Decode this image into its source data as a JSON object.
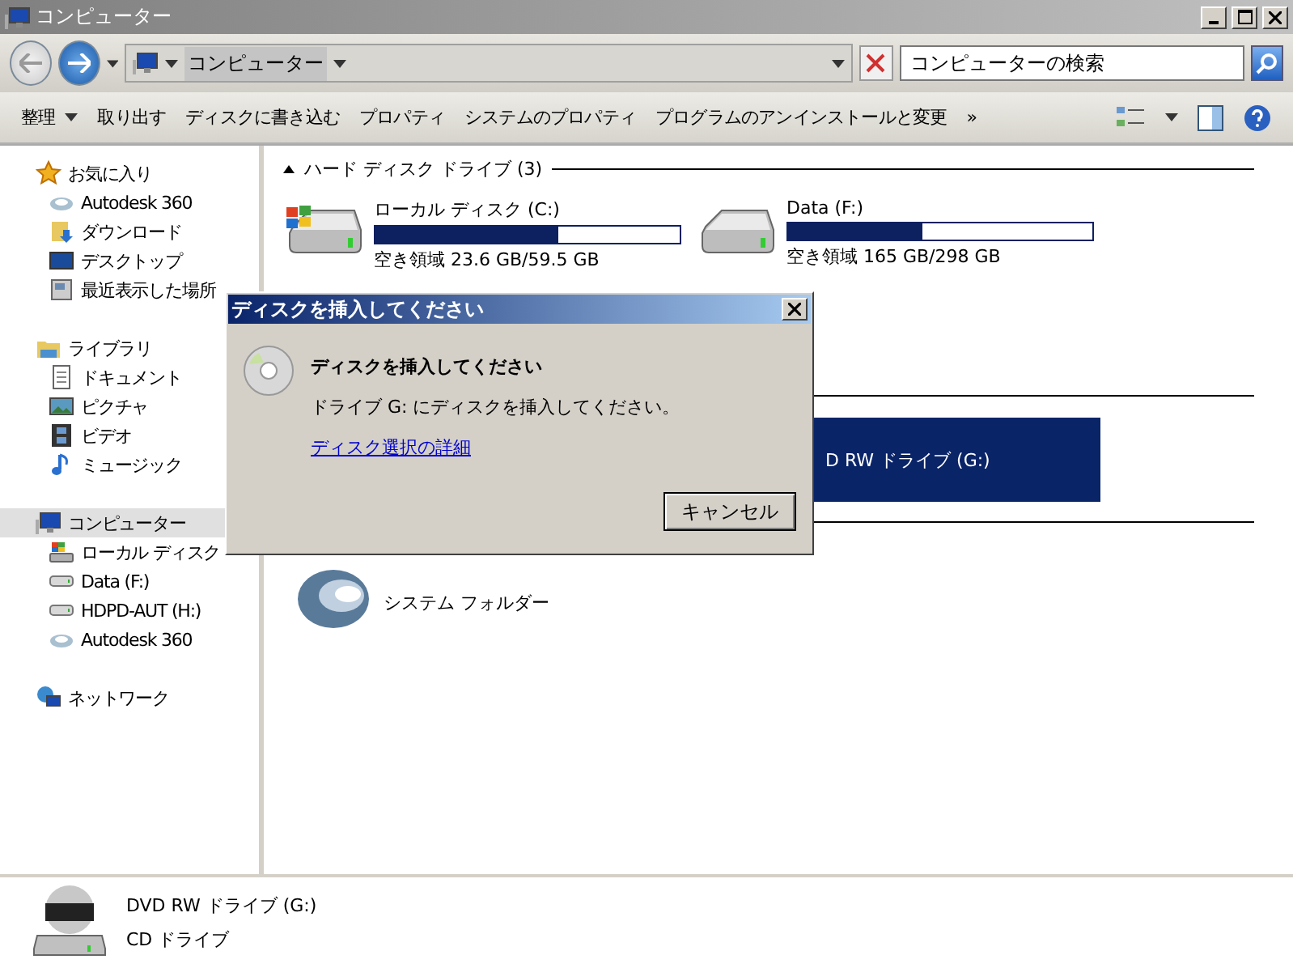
{
  "window": {
    "title": "コンピューター"
  },
  "address": {
    "path": "コンピューター",
    "search_placeholder": "コンピューターの検索"
  },
  "toolbar": [
    {
      "label": "整理",
      "has_menu": true
    },
    {
      "label": "取り出す",
      "has_menu": false
    },
    {
      "label": "ディスクに書き込む",
      "has_menu": false
    },
    {
      "label": "プロパティ",
      "has_menu": false
    },
    {
      "label": "システムのプロパティ",
      "has_menu": false
    },
    {
      "label": "プログラムのアンインストールと変更",
      "has_menu": false
    },
    {
      "label": "»",
      "has_menu": false
    }
  ],
  "sidebar": [
    {
      "label": "お気に入り",
      "kind": "star",
      "selected": false,
      "children": [
        {
          "label": "Autodesk 360",
          "kind": "cloud",
          "selected": false
        },
        {
          "label": "ダウンロード",
          "kind": "download",
          "selected": false
        },
        {
          "label": "デスクトップ",
          "kind": "desktop",
          "selected": false
        },
        {
          "label": "最近表示した場所",
          "kind": "recent",
          "selected": false
        }
      ]
    },
    {
      "label": "ライブラリ",
      "kind": "library",
      "selected": false,
      "children": [
        {
          "label": "ドキュメント",
          "kind": "document",
          "selected": false
        },
        {
          "label": "ピクチャ",
          "kind": "picture",
          "selected": false
        },
        {
          "label": "ビデオ",
          "kind": "video",
          "selected": false
        },
        {
          "label": "ミュージック",
          "kind": "music",
          "selected": false
        }
      ]
    },
    {
      "label": "コンピューター",
      "kind": "computer",
      "selected": true,
      "children": [
        {
          "label": "ローカル ディスク",
          "kind": "windrive",
          "selected": false
        },
        {
          "label": "Data (F:)",
          "kind": "drive",
          "selected": false
        },
        {
          "label": "HDPD-AUT (H:)",
          "kind": "drive",
          "selected": false
        },
        {
          "label": "Autodesk 360",
          "kind": "cloud",
          "selected": false
        }
      ]
    },
    {
      "label": "ネットワーク",
      "kind": "network",
      "selected": false
    }
  ],
  "sections": [
    {
      "title": "ハード ディスク ドライブ (3)",
      "drives": [
        {
          "name": "ローカル ディスク (C:)",
          "kind": "windrive",
          "level": 0.6,
          "free": "空き領域 23.6 GB/59.5 GB"
        },
        {
          "name": "Data (F:)",
          "kind": "drive",
          "level": 0.44,
          "free": "空き領域 165 GB/298 GB"
        }
      ]
    },
    {
      "tile": {
        "name": "D RW ドライブ (G:)",
        "selected": true
      }
    },
    {
      "folder": {
        "type": "システム フォルダー"
      }
    }
  ],
  "dialog": {
    "title": "ディスクを挿入してください",
    "heading": "ディスクを挿入してください",
    "message": "ドライブ G: にディスクを挿入してください。",
    "link": "ディスク選択の詳細",
    "button": "キャンセル"
  },
  "details": {
    "name": "DVD RW ドライブ (G:)",
    "type": "CD ドライブ"
  }
}
